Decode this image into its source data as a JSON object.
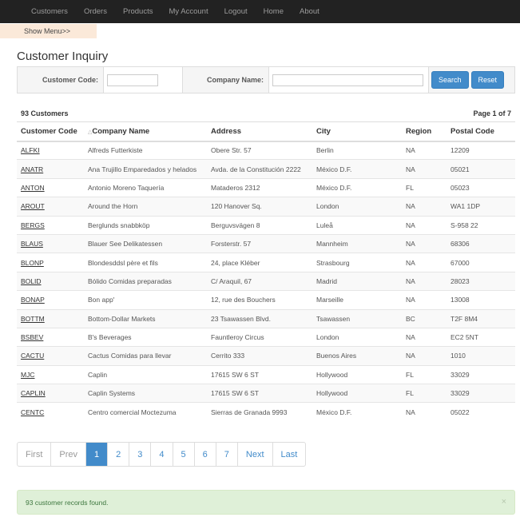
{
  "nav": {
    "items": [
      {
        "label": "Customers"
      },
      {
        "label": "Orders"
      },
      {
        "label": "Products"
      },
      {
        "label": "My Account"
      },
      {
        "label": "Logout"
      },
      {
        "label": "Home"
      },
      {
        "label": "About"
      }
    ]
  },
  "show_menu_label": "Show Menu>>",
  "page_title": "Customer Inquiry",
  "search": {
    "customer_code_label": "Customer Code:",
    "customer_code_value": "",
    "company_name_label": "Company Name:",
    "company_name_value": "",
    "search_button": "Search",
    "reset_button": "Reset"
  },
  "summary": {
    "count_text": "93 Customers",
    "page_text": "Page 1 of  7"
  },
  "table": {
    "sort_indicator": "△",
    "columns": [
      "Customer Code",
      "Company Name",
      "Address",
      "City",
      "Region",
      "Postal Code"
    ],
    "rows": [
      [
        "ALFKI",
        "Alfreds Futterkiste",
        "Obere Str. 57",
        "Berlin",
        "NA",
        "12209"
      ],
      [
        "ANATR",
        "Ana Trujillo Emparedados y helados",
        "Avda. de la Constitución 2222",
        "México D.F.",
        "NA",
        "05021"
      ],
      [
        "ANTON",
        "Antonio Moreno Taquería",
        "Mataderos 2312",
        "México D.F.",
        "FL",
        "05023"
      ],
      [
        "AROUT",
        "Around the Horn",
        "120 Hanover Sq.",
        "London",
        "NA",
        "WA1 1DP"
      ],
      [
        "BERGS",
        "Berglunds snabbköp",
        "Berguvsvägen 8",
        "Luleå",
        "NA",
        "S-958 22"
      ],
      [
        "BLAUS",
        "Blauer See Delikatessen",
        "Forsterstr. 57",
        "Mannheim",
        "NA",
        "68306"
      ],
      [
        "BLONP",
        "Blondesddsl père et fils",
        "24, place Kléber",
        "Strasbourg",
        "NA",
        "67000"
      ],
      [
        "BOLID",
        "Bólido Comidas preparadas",
        "C/ Araquil, 67",
        "Madrid",
        "NA",
        "28023"
      ],
      [
        "BONAP",
        "Bon app'",
        "12, rue des Bouchers",
        "Marseille",
        "NA",
        "13008"
      ],
      [
        "BOTTM",
        "Bottom-Dollar Markets",
        "23 Tsawassen Blvd.",
        "Tsawassen",
        "BC",
        "T2F 8M4"
      ],
      [
        "BSBEV",
        "B's Beverages",
        "Fauntleroy Circus",
        "London",
        "NA",
        "EC2 5NT"
      ],
      [
        "CACTU",
        "Cactus Comidas para llevar",
        "Cerrito 333",
        "Buenos Aires",
        "NA",
        "1010"
      ],
      [
        "MJC",
        "Caplin",
        "17615 SW 6 ST",
        "Hollywood",
        "FL",
        "33029"
      ],
      [
        "CAPLIN",
        "Caplin Systems",
        "17615 SW 6 ST",
        "Hollywood",
        "FL",
        "33029"
      ],
      [
        "CENTC",
        "Centro comercial Moctezuma",
        "Sierras de Granada 9993",
        "México D.F.",
        "NA",
        "05022"
      ]
    ]
  },
  "pager": {
    "items": [
      {
        "label": "First",
        "state": "disabled"
      },
      {
        "label": "Prev",
        "state": "disabled"
      },
      {
        "label": "1",
        "state": "active"
      },
      {
        "label": "2",
        "state": ""
      },
      {
        "label": "3",
        "state": ""
      },
      {
        "label": "4",
        "state": ""
      },
      {
        "label": "5",
        "state": ""
      },
      {
        "label": "6",
        "state": ""
      },
      {
        "label": "7",
        "state": ""
      },
      {
        "label": "Next",
        "state": ""
      },
      {
        "label": "Last",
        "state": ""
      }
    ]
  },
  "alert": {
    "message": "93 customer records found.",
    "close_glyph": "×"
  }
}
